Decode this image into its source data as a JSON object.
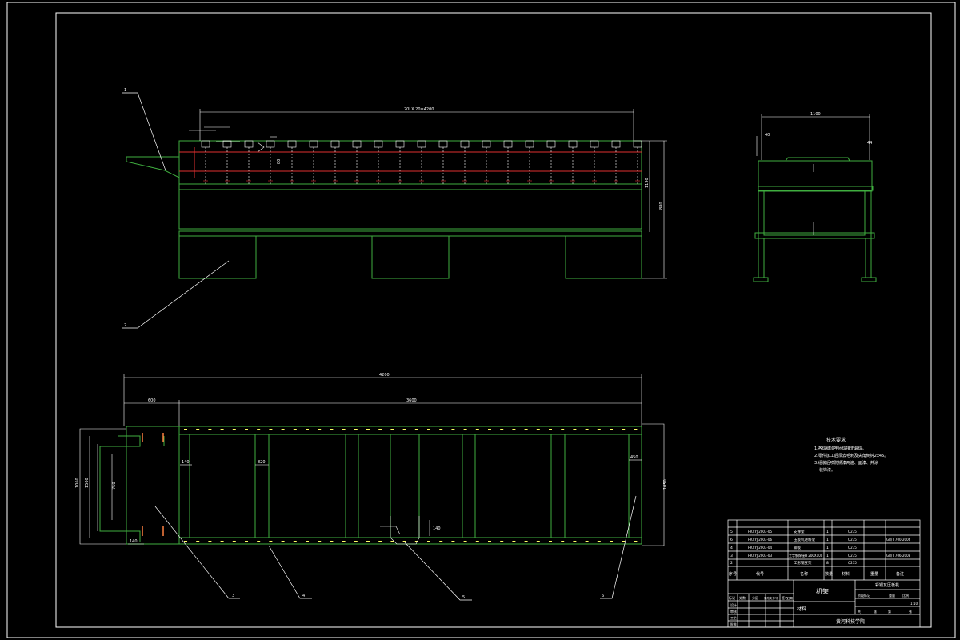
{
  "drawing": {
    "title_main": "机架",
    "title_sub": "彩钢瓦压板机",
    "school": "黄河科技学院",
    "material_label": "材料",
    "dim_side_top": "20LX 20=4200",
    "dim_plan_total": "4200",
    "dim_plan_left": "600",
    "dim_plan_right": "3600",
    "dim_height": "1190",
    "dim_height2": "880",
    "dim_end_width": "1100",
    "dim_plan_w1": "1060",
    "dim_plan_w2": "1500",
    "dim_plan_w3": "750",
    "dim_plan_w4": "1050",
    "dim_small_1": "140",
    "dim_small_2": "820",
    "dim_small_3": "450",
    "dim_small_4": "140",
    "dim_small_5": "140",
    "dim_end_small_1": "40",
    "dim_end_small_2": "44",
    "dim_side_small": "80",
    "callouts": [
      "1",
      "2",
      "3",
      "4",
      "5",
      "6"
    ]
  },
  "notes": {
    "title": "技术要求",
    "lines": [
      "1.各焊缝须牢固焊接无漏焊。",
      "2.零件加工后须去毛刺及尖角倒钝2x45。",
      "3.组装后喷防锈漆两遍、面漆、并涂",
      "装饰漆。"
    ]
  },
  "bom": {
    "header": [
      "序号",
      "代号",
      "名称",
      "数量",
      "材料",
      "重量",
      "备注"
    ],
    "rows": [
      [
        "6",
        "HKXYJ-2003-06",
        "压板机进料架",
        "1",
        "Q235",
        "",
        "GB/T 700-2006"
      ],
      [
        "5",
        "HKXYJ-2003-05",
        "支撑架",
        "1",
        "Q235",
        "",
        ""
      ],
      [
        "4",
        "HKXYJ-2003-04",
        "铆板",
        "1",
        "Q235",
        "",
        ""
      ],
      [
        "3",
        "HKXYJ-2003-03",
        "工字钢焊接H 200X100",
        "1",
        "Q235",
        "",
        "GB/T 706-2008"
      ],
      [
        "2",
        "",
        "工形钢支架",
        "8",
        "Q235",
        "",
        ""
      ]
    ],
    "title_block": [
      "标记",
      "处数",
      "分区",
      "更改文件号",
      "签名",
      "日期"
    ],
    "roles": [
      "设计",
      "审核",
      "工艺",
      "批准"
    ],
    "stage": [
      "阶段标记",
      "重量",
      "比例"
    ],
    "scale": "1:10",
    "sheet": [
      "共",
      "张",
      "第",
      "张"
    ]
  }
}
